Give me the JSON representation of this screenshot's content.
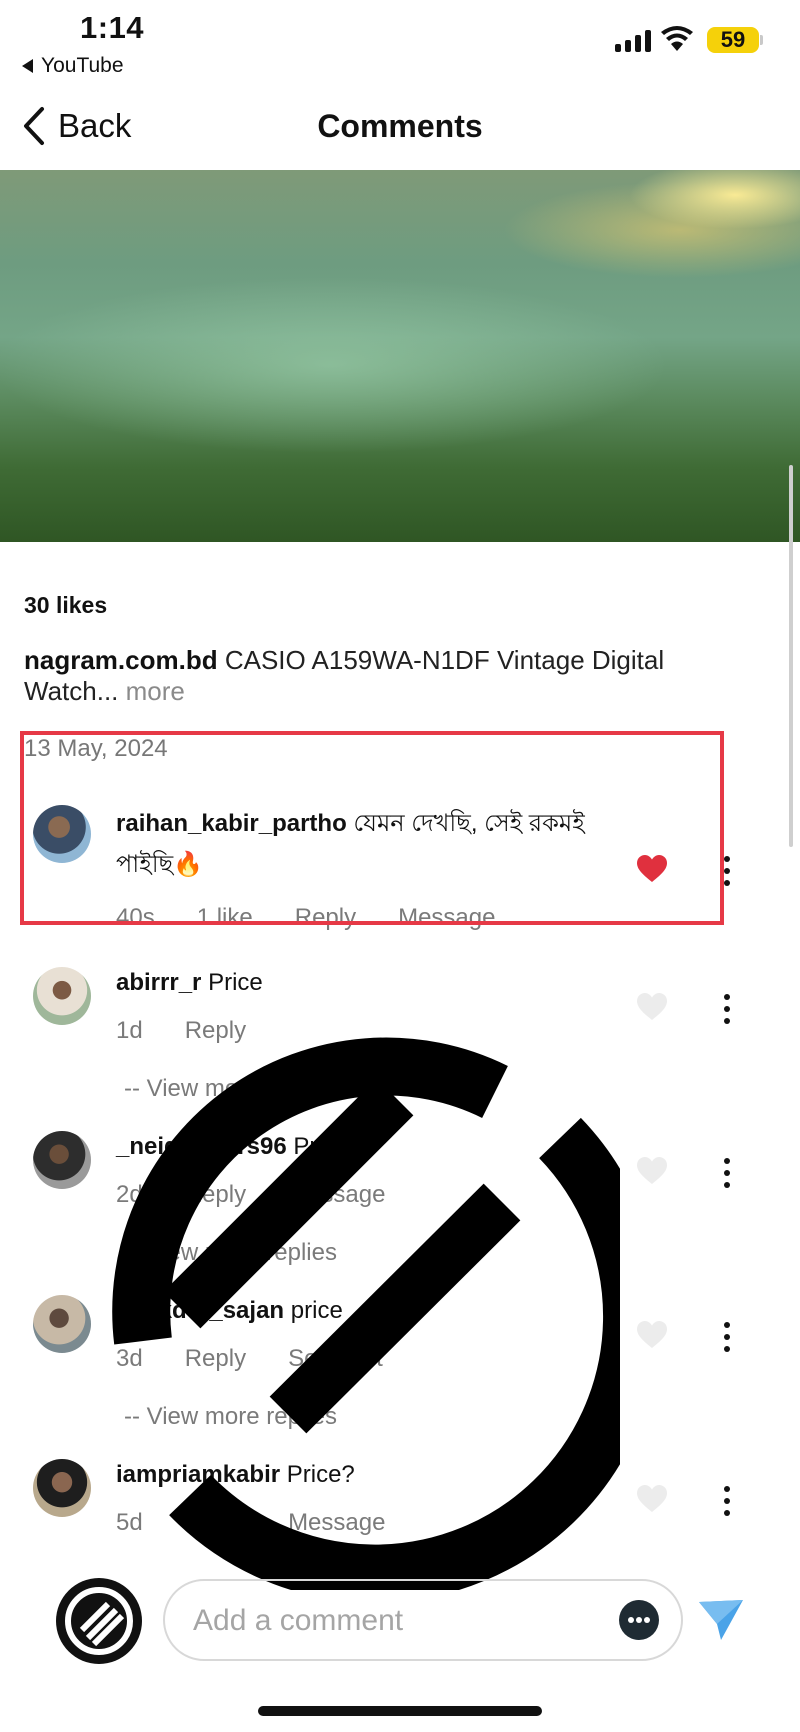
{
  "status_bar": {
    "time": "1:14",
    "back_app": "YouTube",
    "battery": "59"
  },
  "nav": {
    "back_label": "Back",
    "title": "Comments"
  },
  "post": {
    "likes": "30 likes",
    "author": "nagram.com.bd",
    "caption": "CASIO A159WA-N1DF Vintage Digital Watch",
    "ellipsis": "...",
    "more_label": " more",
    "date": "13 May, 2024"
  },
  "comments": [
    {
      "user": "raihan_kabir_partho",
      "text": "যেমন দেখছি, সেই রকমই পাইছি🔥",
      "time": "40s",
      "likes": "1 like",
      "reply": "Reply",
      "action": "Message",
      "liked": true
    },
    {
      "user": "abirrr_r",
      "text": "Price",
      "time": "1d",
      "reply": "Reply",
      "view_more": "-- View more replies",
      "liked": false
    },
    {
      "user": "_neighbours96",
      "text": "Price",
      "time": "2d",
      "reply": "Reply",
      "action": "Message",
      "view_more": "-- View more replies",
      "liked": false
    },
    {
      "user": "talukder_sajan",
      "text": "price",
      "time": "3d",
      "reply": "Reply",
      "action": "See post",
      "view_more": "-- View more replies",
      "liked": false
    },
    {
      "user": "iampriamkabir",
      "text": "Price?",
      "time": "5d",
      "reply": "Reply",
      "action": "Message",
      "liked": false
    }
  ],
  "composer": {
    "placeholder": "Add a comment"
  },
  "colors": {
    "heart_liked": "#e0303e",
    "highlight": "#e63946",
    "send": "#4aa3e8",
    "battery": "#f5d10a"
  }
}
